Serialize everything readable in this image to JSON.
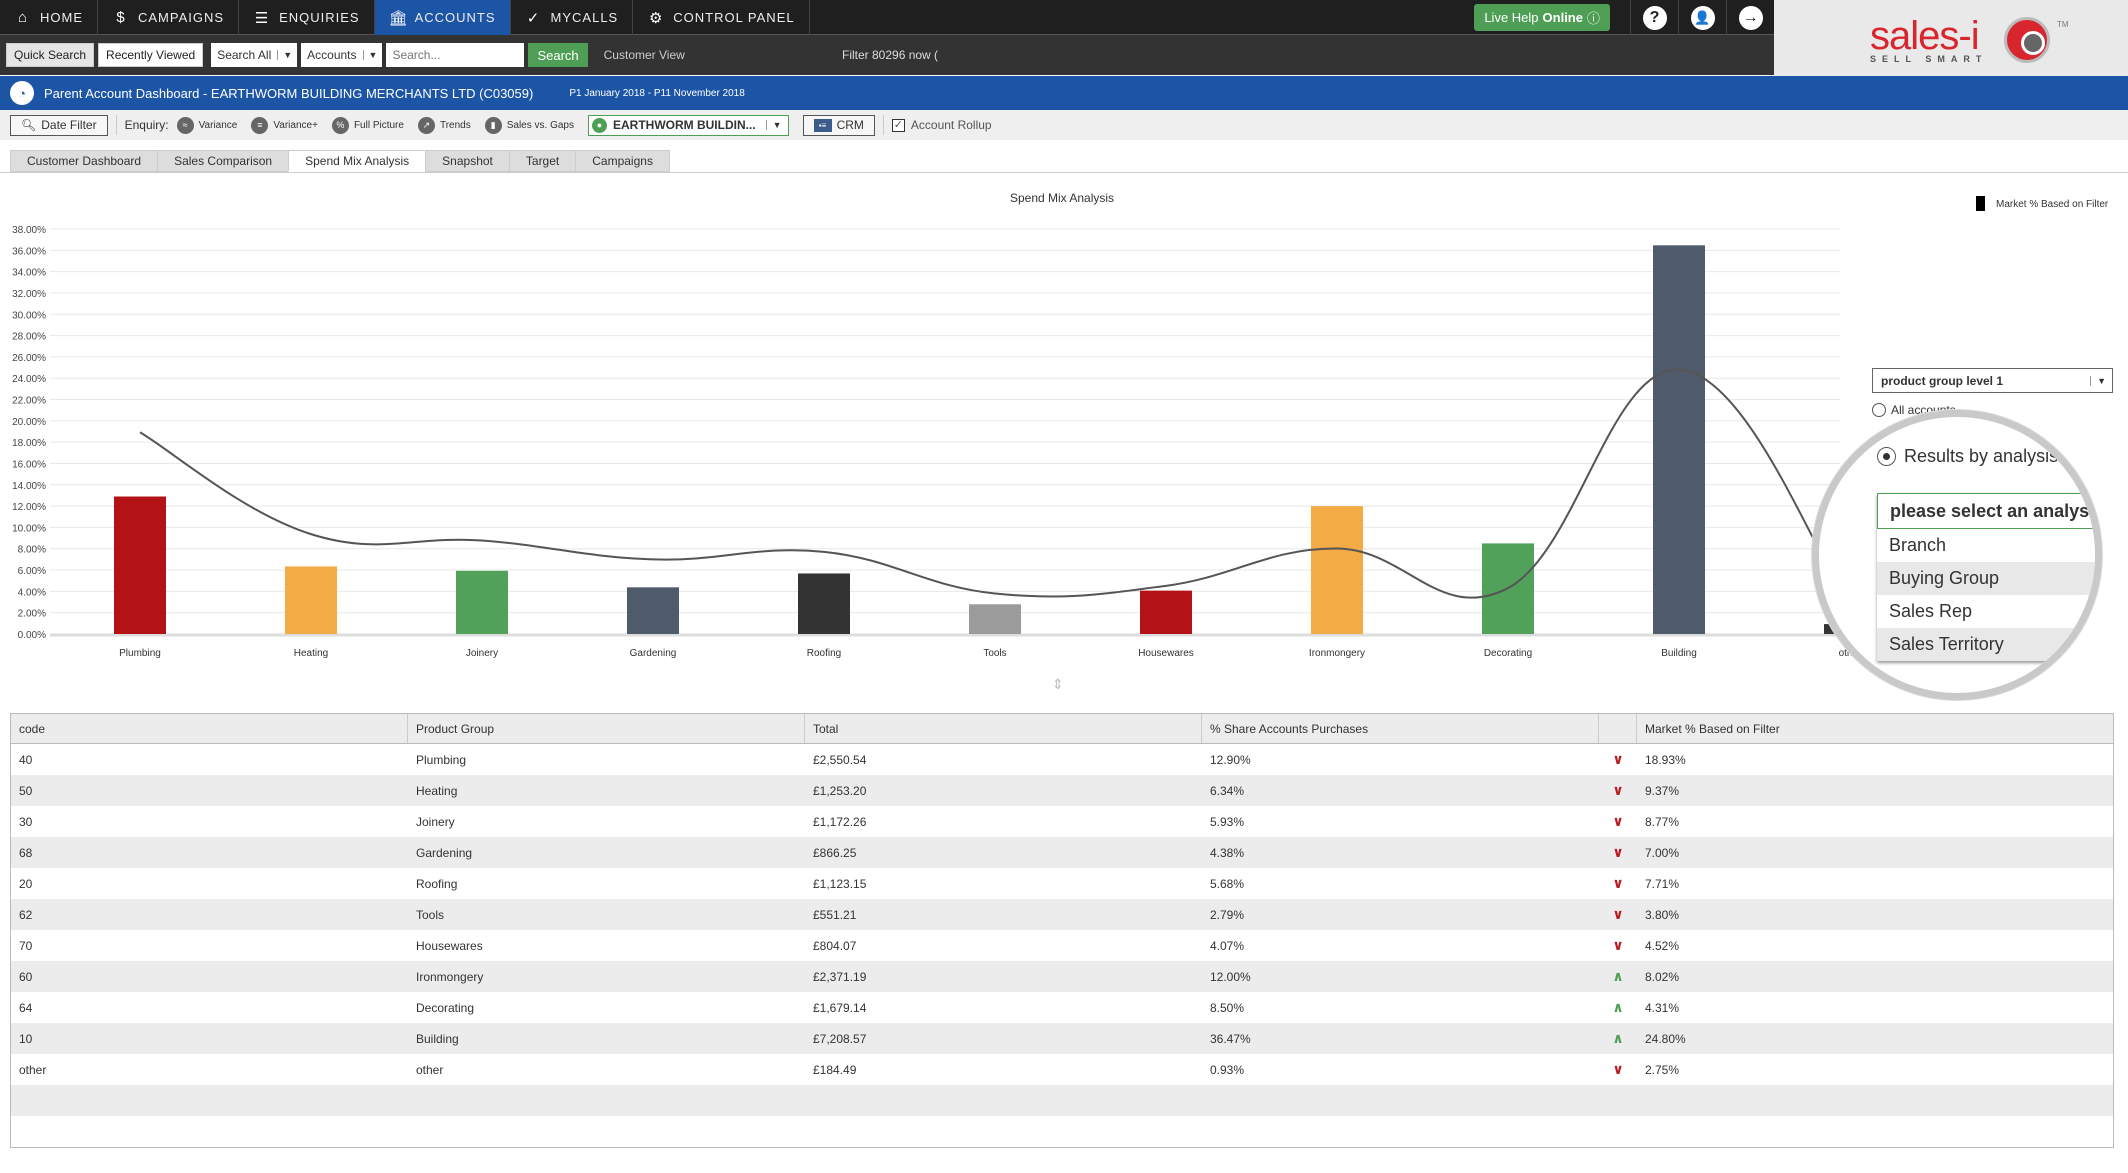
{
  "nav": {
    "items": [
      {
        "label": "HOME",
        "icon": "home-icon",
        "glyph": "⌂",
        "active": false
      },
      {
        "label": "CAMPAIGNS",
        "icon": "campaigns-icon",
        "glyph": "$",
        "active": false
      },
      {
        "label": "ENQUIRIES",
        "icon": "enquiries-icon",
        "glyph": "☰",
        "active": false
      },
      {
        "label": "ACCOUNTS",
        "icon": "accounts-icon",
        "glyph": "🏛",
        "active": true
      },
      {
        "label": "MYCALLS",
        "icon": "mycalls-icon",
        "glyph": "✓",
        "active": false
      },
      {
        "label": "CONTROL PANEL",
        "icon": "control-panel-icon",
        "glyph": "⚙",
        "active": false
      }
    ],
    "live_help": "Live Help",
    "live_help_status": "Online",
    "help_glyph": "?",
    "user_glyph": "👤",
    "logout_glyph": "→"
  },
  "search": {
    "quick_search": "Quick Search",
    "recently_viewed": "Recently Viewed",
    "scope_select": "Search All",
    "type_select": "Accounts",
    "placeholder": "Search...",
    "search_button": "Search",
    "customer_view": "Customer View",
    "filter_note": "Filter 80296 now ("
  },
  "logo": {
    "name": "sales-i",
    "tagline": "SELL SMART",
    "tm": "TM"
  },
  "title": {
    "text": "Parent Account Dashboard - EARTHWORM BUILDING MERCHANTS LTD (C03059)",
    "period": "P1 January 2018 - P11 November 2018"
  },
  "toolbar": {
    "date_filter": "Date Filter",
    "enquiry_label": "Enquiry:",
    "enquiries": [
      "Variance",
      "Variance+",
      "Full Picture",
      "Trends",
      "Sales vs. Gaps"
    ],
    "account_select": "EARTHWORM BUILDIN...",
    "crm": "CRM",
    "account_rollup": "Account Rollup",
    "account_rollup_checked": true
  },
  "tabs": [
    {
      "label": "Customer Dashboard",
      "active": false
    },
    {
      "label": "Sales Comparison",
      "active": false
    },
    {
      "label": "Spend Mix Analysis",
      "active": true
    },
    {
      "label": "Snapshot",
      "active": false
    },
    {
      "label": "Target",
      "active": false
    },
    {
      "label": "Campaigns",
      "active": false
    }
  ],
  "controls": {
    "level_select": "product group level 1",
    "radio_all": "All accounts",
    "radio_analysis": "Results by analysis ...",
    "analysis_options": [
      "please select an analysis",
      "Branch",
      "Buying Group",
      "Sales Rep",
      "Sales Territory"
    ],
    "analysis_selected": "please select an analysis"
  },
  "chart_data": {
    "type": "bar",
    "title": "Spend Mix Analysis",
    "xlabel": "",
    "ylabel": "",
    "ylim": [
      0,
      38
    ],
    "ytick_step": 2,
    "ytick_format": "percent_2dp",
    "grid": true,
    "legend": {
      "position": "top-right",
      "entries": [
        "Market % Based on Filter"
      ]
    },
    "categories": [
      "Plumbing",
      "Heating",
      "Joinery",
      "Gardening",
      "Roofing",
      "Tools",
      "Housewares",
      "Ironmongery",
      "Decorating",
      "Building",
      "other"
    ],
    "series": [
      {
        "name": "% Share Accounts Purchases",
        "kind": "bar",
        "values": [
          12.9,
          6.34,
          5.93,
          4.38,
          5.68,
          2.79,
          4.07,
          12.0,
          8.5,
          36.47,
          0.93
        ],
        "colors": [
          "#b31217",
          "#f2ab45",
          "#52a15a",
          "#4f5b6b",
          "#333333",
          "#9b9b9b",
          "#b31217",
          "#f2ab45",
          "#52a15a",
          "#4f5b6b",
          "#333333"
        ]
      },
      {
        "name": "Market % Based on Filter",
        "kind": "smooth-line",
        "color": "#555555",
        "values": [
          18.93,
          9.37,
          8.77,
          7.0,
          7.71,
          3.8,
          4.52,
          8.02,
          4.31,
          24.8,
          2.75
        ]
      }
    ]
  },
  "table": {
    "headers": [
      "code",
      "Product Group",
      "Total",
      "% Share Accounts Purchases",
      "",
      "Market % Based on Filter"
    ],
    "rows": [
      {
        "code": "40",
        "group": "Plumbing",
        "total": "£2,550.54",
        "share": "12.90%",
        "trend": "down",
        "market": "18.93%"
      },
      {
        "code": "50",
        "group": "Heating",
        "total": "£1,253.20",
        "share": "6.34%",
        "trend": "down",
        "market": "9.37%"
      },
      {
        "code": "30",
        "group": "Joinery",
        "total": "£1,172.26",
        "share": "5.93%",
        "trend": "down",
        "market": "8.77%"
      },
      {
        "code": "68",
        "group": "Gardening",
        "total": "£866.25",
        "share": "4.38%",
        "trend": "down",
        "market": "7.00%"
      },
      {
        "code": "20",
        "group": "Roofing",
        "total": "£1,123.15",
        "share": "5.68%",
        "trend": "down",
        "market": "7.71%"
      },
      {
        "code": "62",
        "group": "Tools",
        "total": "£551.21",
        "share": "2.79%",
        "trend": "down",
        "market": "3.80%"
      },
      {
        "code": "70",
        "group": "Housewares",
        "total": "£804.07",
        "share": "4.07%",
        "trend": "down",
        "market": "4.52%"
      },
      {
        "code": "60",
        "group": "Ironmongery",
        "total": "£2,371.19",
        "share": "12.00%",
        "trend": "up",
        "market": "8.02%"
      },
      {
        "code": "64",
        "group": "Decorating",
        "total": "£1,679.14",
        "share": "8.50%",
        "trend": "up",
        "market": "4.31%"
      },
      {
        "code": "10",
        "group": "Building",
        "total": "£7,208.57",
        "share": "36.47%",
        "trend": "up",
        "market": "24.80%"
      },
      {
        "code": "other",
        "group": "other",
        "total": "£184.49",
        "share": "0.93%",
        "trend": "down",
        "market": "2.75%"
      }
    ],
    "empty_rows": 2,
    "trend_glyphs": {
      "down": "∨",
      "up": "∧"
    }
  }
}
